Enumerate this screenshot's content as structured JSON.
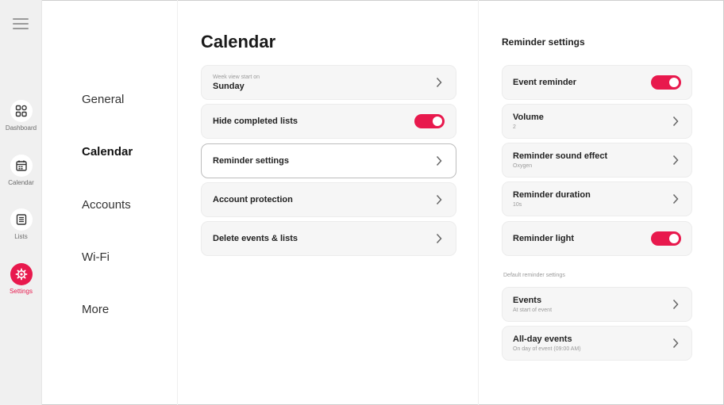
{
  "rail": {
    "items": [
      {
        "label": "Dashboard",
        "icon": "dashboard-icon"
      },
      {
        "label": "Calendar",
        "icon": "calendar-icon"
      },
      {
        "label": "Lists",
        "icon": "list-icon"
      },
      {
        "label": "Settings",
        "icon": "gear-icon",
        "active": true
      }
    ]
  },
  "categories": [
    "General",
    "Calendar",
    "Accounts",
    "Wi-Fi",
    "More"
  ],
  "main": {
    "title": "Calendar",
    "week_start": {
      "caption": "Week view start on",
      "value": "Sunday"
    },
    "hide_completed": {
      "label": "Hide completed lists",
      "on": true
    },
    "reminder_settings": {
      "label": "Reminder settings"
    },
    "account_protection": {
      "label": "Account protection"
    },
    "delete_events": {
      "label": "Delete events & lists"
    }
  },
  "panel": {
    "title": "Reminder settings",
    "event_reminder": {
      "label": "Event reminder",
      "on": true
    },
    "volume": {
      "label": "Volume",
      "value": "2"
    },
    "sound_effect": {
      "label": "Reminder sound effect",
      "value": "Oxygen"
    },
    "duration": {
      "label": "Reminder duration",
      "value": "10s"
    },
    "light": {
      "label": "Reminder light",
      "on": true
    },
    "defaults_caption": "Default reminder settings",
    "events": {
      "label": "Events",
      "value": "At start of event"
    },
    "all_day": {
      "label": "All-day events",
      "value": "On day of event (09:00 AM)"
    }
  },
  "colors": {
    "accent": "#e8194d",
    "row_bg": "#f6f6f6",
    "rail_bg": "#f0f0f0"
  }
}
